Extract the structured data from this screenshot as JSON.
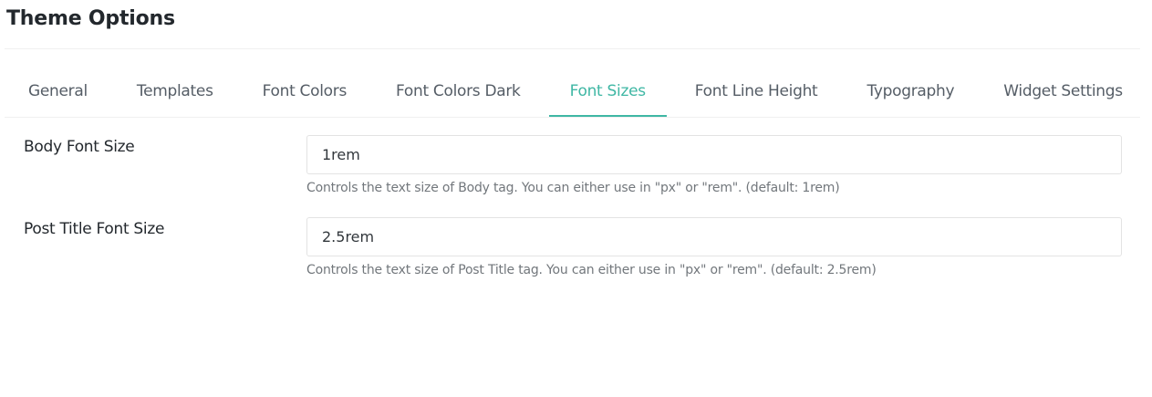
{
  "page": {
    "title": "Theme Options"
  },
  "tabs": [
    {
      "label": "General"
    },
    {
      "label": "Templates"
    },
    {
      "label": "Font Colors"
    },
    {
      "label": "Font Colors Dark"
    },
    {
      "label": "Font Sizes",
      "active": true
    },
    {
      "label": "Font Line Height"
    },
    {
      "label": "Typography"
    },
    {
      "label": "Widget Settings"
    }
  ],
  "fields": {
    "body_font_size": {
      "label": "Body Font Size",
      "value": "1rem",
      "help": "Controls the text size of Body tag. You can either use in \"px\" or \"rem\". (default: 1rem)"
    },
    "post_title_font_size": {
      "label": "Post Title Font Size",
      "value": "2.5rem",
      "help": "Controls the text size of Post Title tag. You can either use in \"px\" or \"rem\". (default: 2.5rem)"
    }
  },
  "colors": {
    "accent": "#3fb7a4",
    "text": "#23282d",
    "muted": "#72777c"
  }
}
